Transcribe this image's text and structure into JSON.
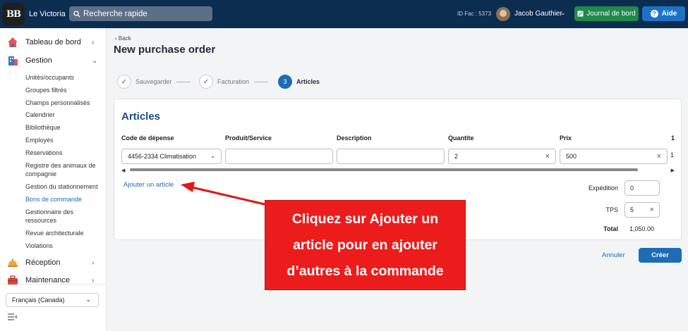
{
  "app": {
    "name": "Le Victoria",
    "logo_text": "BB"
  },
  "search": {
    "placeholder": "Recherche rapide",
    "icon": "search-icon"
  },
  "header": {
    "facility_id": "ID Fac : 5373",
    "user_name": "Jacob Gauthier",
    "journal_button": "Journal de bord",
    "help_button": "Aide"
  },
  "sidebar": {
    "sections": [
      {
        "label": "Tableau de bord",
        "icon": "house-icon",
        "chevron": "›"
      },
      {
        "label": "Gestion",
        "icon": "building-icon",
        "chevron": "⌄"
      },
      {
        "label": "Réception",
        "icon": "bell-icon",
        "chevron": "›"
      },
      {
        "label": "Maintenance",
        "icon": "toolbox-icon",
        "chevron": "›"
      }
    ],
    "gestion_items": [
      "Unités/occupants",
      "Groupes filtrés",
      "Champs personnalisés",
      "Calendrier",
      "Bibliothèque",
      "Employés",
      "Réservations",
      "Registre des animaux de compagnie",
      "Gestion du stationnement",
      "Bons de commande",
      "Gestionnaire des ressources",
      "Revue architecturale",
      "Violations"
    ],
    "active_item": "Bons de commande",
    "language": "Français (Canada)"
  },
  "page": {
    "back_label": "Back",
    "title": "New purchase order"
  },
  "steps": [
    {
      "label": "Sauvegarder",
      "state": "done",
      "marker": "✓"
    },
    {
      "label": "Facturation",
      "state": "done",
      "marker": "✓"
    },
    {
      "label": "Articles",
      "state": "current",
      "marker": "3"
    }
  ],
  "articles": {
    "title": "Articles",
    "columns": [
      "Code de dépense",
      "Produit/Service",
      "Description",
      "Quantite",
      "Prix",
      "1"
    ],
    "row": {
      "expense_code": "4456-2334 Climatisation",
      "product": "",
      "description": "",
      "quantity": "2",
      "price": "500",
      "overflow": "1"
    },
    "add_link": "Ajouter un article",
    "shipping_label": "Expédition",
    "shipping_value": "0",
    "tps_label": "TPS",
    "tps_value": "5",
    "total_label": "Total",
    "total_value": "1,050.00"
  },
  "actions": {
    "cancel": "Annuler",
    "create": "Créer"
  },
  "callout": {
    "lines": [
      "Cliquez sur Ajouter un",
      "article pour en ajouter",
      "d’autres à la commande"
    ],
    "color": "#ed1c1c"
  }
}
